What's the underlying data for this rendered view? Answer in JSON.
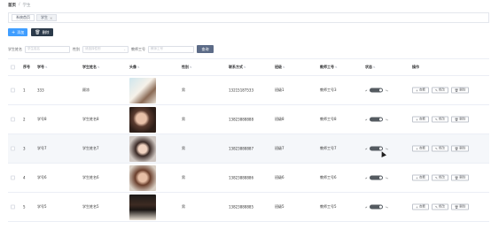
{
  "breadcrumb": {
    "home": "首页",
    "sep": "/",
    "current": "学生"
  },
  "tabs": [
    {
      "label": "系统首页",
      "closable": false,
      "active": false
    },
    {
      "label": "学生",
      "closable": true,
      "active": true
    }
  ],
  "actions": {
    "add": "添加",
    "delete": "删除"
  },
  "search": {
    "name_label": "学生姓名",
    "name_placeholder": "学生姓名",
    "gender_label": "性别",
    "gender_placeholder": "请选择性别",
    "teacher_label": "教师工号",
    "teacher_placeholder": "教师工号",
    "button": "查询"
  },
  "columns": {
    "index": "序号",
    "student_no": "学号",
    "student_name": "学生姓名",
    "avatar": "头像",
    "gender": "性别",
    "contact": "联系方式",
    "class": "班级",
    "teacher_no": "教师工号",
    "status": "状态",
    "ops": "操作"
  },
  "rows": [
    {
      "index": "1",
      "student_no": "333",
      "student_name": "顾凉",
      "avatar": "photo-1",
      "gender": "男",
      "contact": "13215187533",
      "class": "班级1",
      "teacher_no": "教师工号3"
    },
    {
      "index": "2",
      "student_no": "学号8",
      "student_name": "学生姓名8",
      "avatar": "photo-2",
      "gender": "男",
      "contact": "13823888888",
      "class": "班级8",
      "teacher_no": "教师工号8"
    },
    {
      "index": "3",
      "student_no": "学号7",
      "student_name": "学生姓名7",
      "avatar": "photo-3",
      "gender": "男",
      "contact": "13823888887",
      "class": "班级7",
      "teacher_no": "教师工号7"
    },
    {
      "index": "4",
      "student_no": "学号6",
      "student_name": "学生姓名6",
      "avatar": "photo-4",
      "gender": "男",
      "contact": "13823888886",
      "class": "班级6",
      "teacher_no": "教师工号6"
    },
    {
      "index": "5",
      "student_no": "学号5",
      "student_name": "学生姓名5",
      "avatar": "photo-5",
      "gender": "男",
      "contact": "13823888885",
      "class": "班级5",
      "teacher_no": "教师工号5"
    }
  ],
  "row_ops": {
    "view": "查看",
    "edit": "修改",
    "delete": "删除"
  },
  "colors": {
    "primary": "#409eff",
    "dark_button": "#2b3a4a",
    "query_button": "#5c6b87",
    "toggle": "#555b61"
  }
}
